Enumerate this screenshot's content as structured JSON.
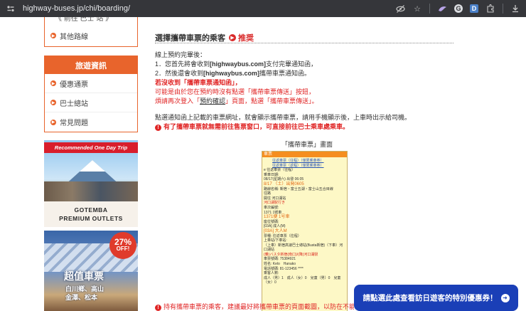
{
  "browser": {
    "url": "highway-buses.jp/chi/boarding/"
  },
  "sidebar": {
    "top_cut_text": "《 前往 巴士 站 》",
    "top_items": [
      {
        "label": "其他路線"
      }
    ],
    "travel_title": "旅遊資訊",
    "travel_items": [
      {
        "label": "優惠通票"
      },
      {
        "label": "巴士總站"
      },
      {
        "label": "常見問題"
      }
    ]
  },
  "banners": {
    "gotemba": {
      "ribbon": "Recommended One Day Trip",
      "line1": "GOTEMBA",
      "line2": "PREMIUM OUTLETS"
    },
    "ticket_deal": {
      "percent": "27%",
      "off": "OFF!",
      "title": "超值車票",
      "sub1": "白川鄉、高山",
      "sub2": "金澤、松本"
    }
  },
  "main": {
    "title": "選擇攜帶車票的乘客",
    "recommend": "推奨",
    "intro": "線上預約完畢後：",
    "step1_prefix": "1．您首先將會收到",
    "step1_bold": "[highwaybus.com]",
    "step1_suffix": "支付完畢通知函，",
    "step2_prefix": "2．然後還會收到",
    "step2_bold": "[highwaybus.com]",
    "step2_suffix": "攜帶車票通知函。",
    "red_bold": "若沒收到「攜帶車票通知函」，",
    "red_line2": "可能是由於您在預約時沒有點選「攜帶車票傳送」按鈕，",
    "red_line3_prefix": "煩請再次登入「",
    "red_line3_link": "預約確認",
    "red_line3_suffix": "」頁面，點選「攜帶車票傳送」。",
    "instruction": "點選通知函上記載的車票網址，就會顯示攜帶車票，請用手機顯示後，上車時出示給司機。",
    "warning": "有了攜帶車票就無需前往售票窗口，可直接前往巴士乘車處乘車。",
    "ticket_caption": "「攜帶車票」畫面",
    "bottom_warning": "持有攜帶車票的乘客，建議最好將攜帶車票的頁面截圖，以防在不能上網"
  },
  "ticket_sample": {
    "header": "車票",
    "lines": [
      {
        "text": "往返車票（往程）（僅限乘車券）",
        "style": "link"
      },
      {
        "text": "往返車票（返程）（僅限乘車券）",
        "style": "link"
      },
      {
        "text": "e 往返車票（往程）",
        "style": "normal"
      },
      {
        "text": "乘車日期:",
        "style": "normal"
      },
      {
        "text": "08/17(星期六) 出發 06:05",
        "style": "normal"
      },
      {
        "text": "8/17 （土）出発0605",
        "style": "orange"
      },
      {
        "text": "路線名稱: 新宿・富士五湖・富士山五合目線",
        "style": "normal"
      },
      {
        "text": "往路",
        "style": "normal"
      },
      {
        "text": "開往 河口湖站",
        "style": "normal"
      },
      {
        "text": "河口湖駅行き",
        "style": "red"
      },
      {
        "text": "車次編號:",
        "style": "normal"
      },
      {
        "text": "1371 1號車",
        "style": "normal"
      },
      {
        "text": "1371便 1号車",
        "style": "orange"
      },
      {
        "text": "座位號碼:",
        "style": "normal"
      },
      {
        "text": "[03A] 成人(M)",
        "style": "normal"
      },
      {
        "text": "[03A] 大人M",
        "style": "orange"
      },
      {
        "text": "票種: 往返車票（往程）",
        "style": "normal"
      },
      {
        "text": "上車站/下車站:",
        "style": "normal"
      },
      {
        "text": "（上車）新宿高速巴士總站(Busta新宿)（下車）河口湖站",
        "style": "mixed"
      },
      {
        "text": "(乗)バスタ新宿(南口)/(降)河口湖駅",
        "style": "red"
      },
      {
        "text": "車票號碼: 75384921",
        "style": "normal"
      },
      {
        "text": "姓名: Kelo　Hanako",
        "style": "normal"
      },
      {
        "text": "電話號碼: 81-123456 ****",
        "style": "normal"
      },
      {
        "text": "乘客人數:",
        "style": "normal"
      },
      {
        "text": "成人（男）1　成人（女）0　兒童（男）0　兒童（女）0",
        "style": "normal"
      }
    ]
  },
  "cta": {
    "label": "請點選此處查看訪日遊客的特別優惠券！"
  }
}
